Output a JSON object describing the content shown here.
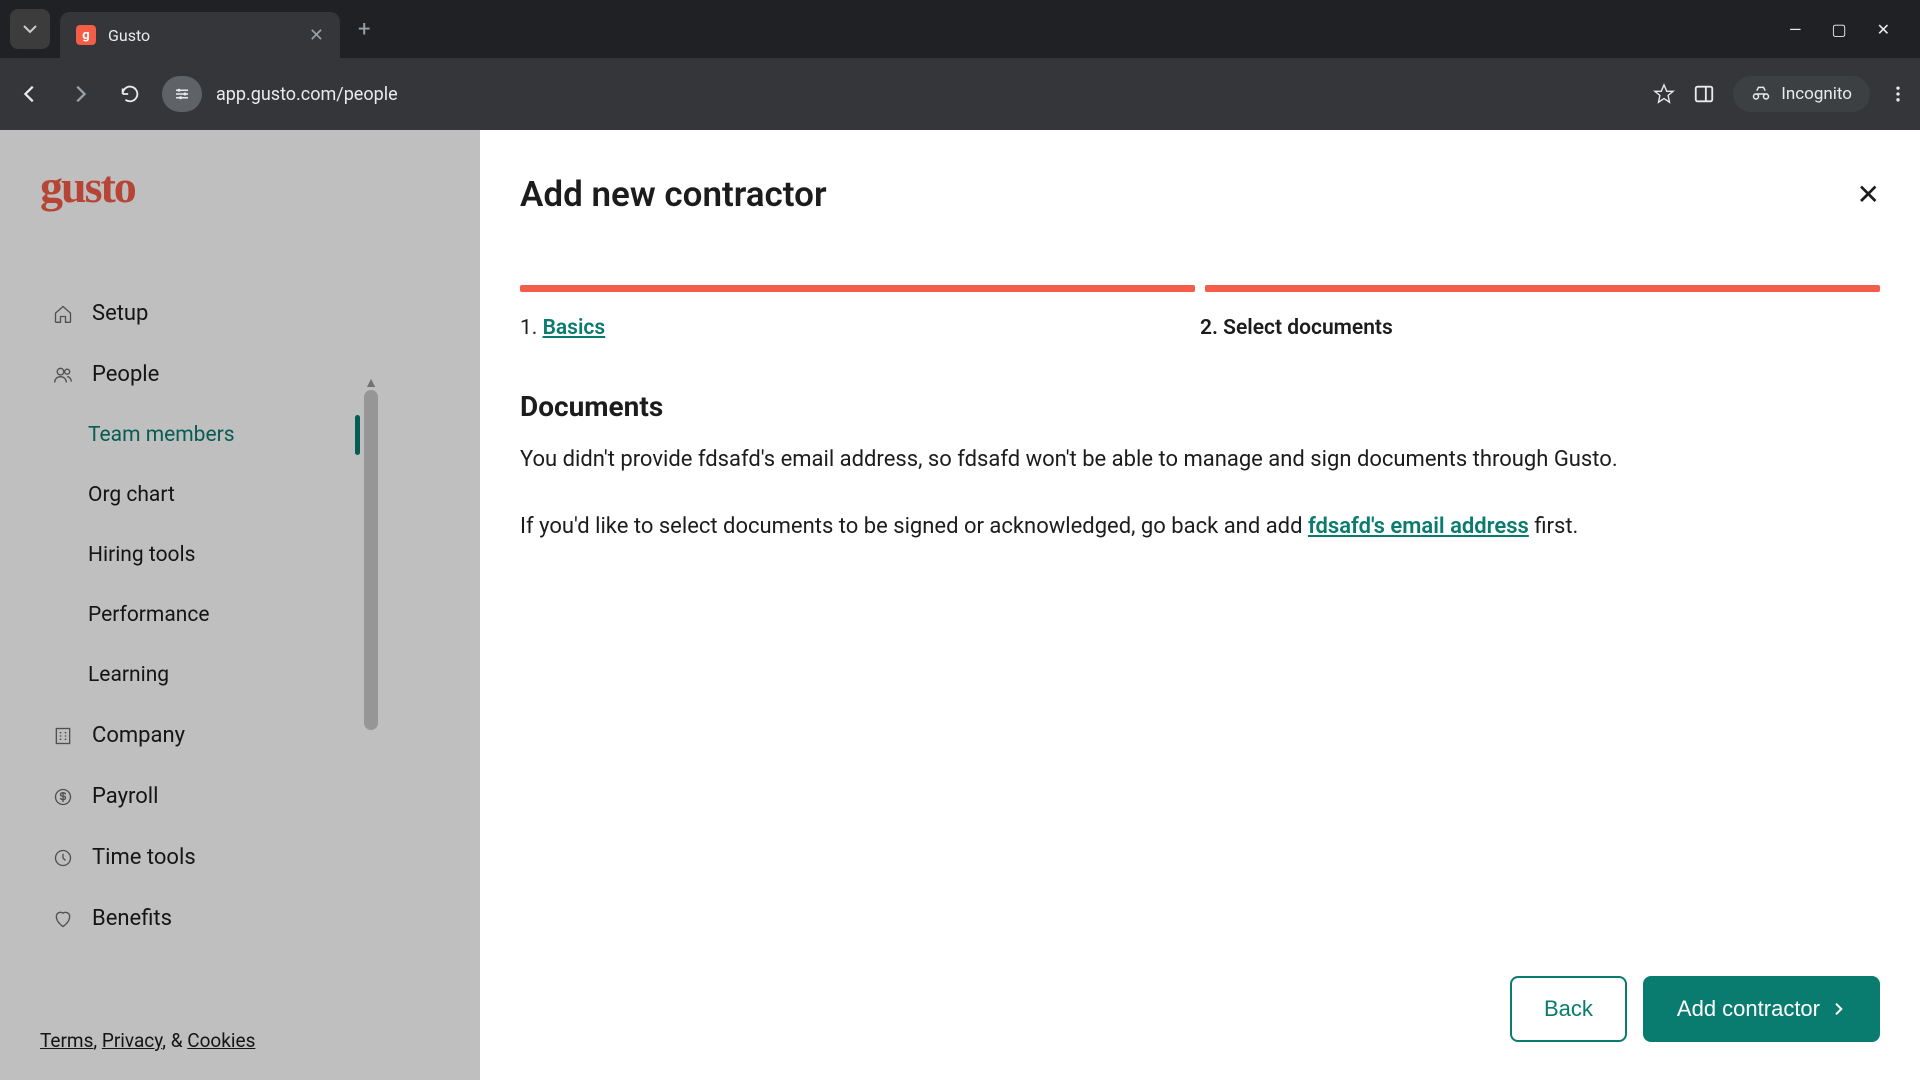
{
  "browser": {
    "tab_title": "Gusto",
    "url": "app.gusto.com/people",
    "incognito_label": "Incognito"
  },
  "sidebar": {
    "logo": "gusto",
    "items": [
      {
        "label": "Setup",
        "icon": "home"
      },
      {
        "label": "People",
        "icon": "users"
      },
      {
        "label": "Team members",
        "sub": true,
        "active": true
      },
      {
        "label": "Org chart",
        "sub": true
      },
      {
        "label": "Hiring tools",
        "sub": true
      },
      {
        "label": "Performance",
        "sub": true
      },
      {
        "label": "Learning",
        "sub": true
      },
      {
        "label": "Company",
        "icon": "building"
      },
      {
        "label": "Payroll",
        "icon": "dollar"
      },
      {
        "label": "Time tools",
        "icon": "clock"
      },
      {
        "label": "Benefits",
        "icon": "heart"
      }
    ],
    "footer": {
      "terms": "Terms",
      "privacy": "Privacy",
      "cookies": "Cookies",
      "sep1": ", ",
      "sep2": ", & "
    }
  },
  "modal": {
    "title": "Add new contractor",
    "steps": {
      "s1_num": "1. ",
      "s1_label": "Basics",
      "s2": "2. Select documents"
    },
    "section_title": "Documents",
    "para1": "You didn't provide fdsafd's email address, so fdsafd won't be able to manage and sign documents through Gusto.",
    "para2_a": "If you'd like to select documents to be signed or acknowledged, go back and add ",
    "para2_link": "fdsafd's email address",
    "para2_b": " first.",
    "back": "Back",
    "submit": "Add contractor"
  }
}
